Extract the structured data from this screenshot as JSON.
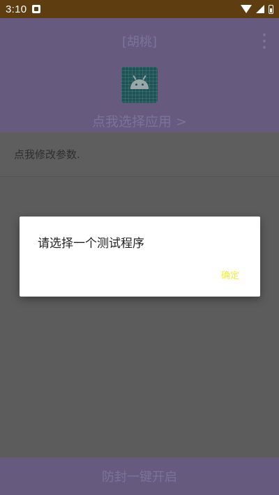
{
  "status_bar": {
    "time": "3:10",
    "icons": [
      "notification-icon",
      "wifi-icon",
      "signal-icon",
      "battery-icon"
    ]
  },
  "header": {
    "title": "[胡桃]",
    "menu_icon": "overflow-menu-icon",
    "app_icon": "android-icon",
    "select_app_label": "点我选择应用 >"
  },
  "params": {
    "label": "点我修改参数."
  },
  "bottom": {
    "button_label": "防封一键开启"
  },
  "dialog": {
    "message": "请选择一个测试程序",
    "ok_label": "确定"
  },
  "colors": {
    "status_bar": "#5e3d10",
    "header": "#665a7e",
    "scrim": "#5c5c5c",
    "dialog_ok": "#f3ee3a"
  }
}
